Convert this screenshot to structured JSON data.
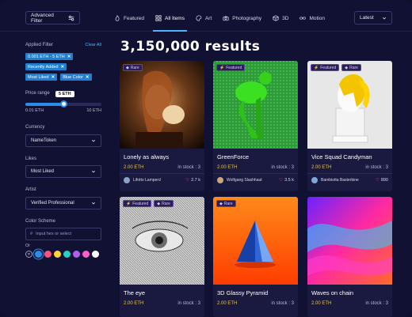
{
  "topbar": {
    "advanced_filter": "Advanced Filter",
    "tabs": [
      {
        "label": "Featured",
        "icon": "flame-icon"
      },
      {
        "label": "All Items",
        "icon": "grid-icon"
      },
      {
        "label": "Art",
        "icon": "palette-icon"
      },
      {
        "label": "Photography",
        "icon": "camera-icon"
      },
      {
        "label": "3D",
        "icon": "cube-icon"
      },
      {
        "label": "Motion",
        "icon": "glasses-icon"
      }
    ],
    "sort": "Latest"
  },
  "sidebar": {
    "applied_filter": "Applied Filter",
    "clear_all": "Clear All",
    "chips": [
      "0.001 ETH - 5 ETH",
      "Recently Added",
      "Most Liked",
      "Blue Color"
    ],
    "price_range": "Price range",
    "price_tip": "5 ETH",
    "price_level": 0.5,
    "price_min": "0.01 ETH",
    "price_max": "10 ETH",
    "currency_label": "Currency",
    "currency_value": "NameToken",
    "likes_label": "Likes",
    "likes_value": "Most Liked",
    "artist_label": "Artist",
    "artist_value": "Verified Professional",
    "color_label": "Color Scheme",
    "color_placeholder": "Input hex or select",
    "or_label": "Or",
    "swatches": [
      "#2b8de6",
      "#ff4f7b",
      "#ffd23a",
      "#22d3c5",
      "#b05cf0",
      "#ff5ec8",
      "#ffffff"
    ]
  },
  "main": {
    "results": "3,150,000 results",
    "badge_featured": "Featured",
    "badge_rare": "Rare",
    "cards": [
      {
        "title": "Lonely as always",
        "price": "2.00 ETH",
        "stock": "in stock : 3",
        "owner": "Lifotto Lamperd",
        "likes": "2.7 k"
      },
      {
        "title": "GreenForce",
        "price": "2.00 ETH",
        "stock": "in stock : 3",
        "owner": "Wolfgang Slashhaut",
        "likes": "3.5 k"
      },
      {
        "title": "Vice Squad Candyman",
        "price": "2.00 ETH",
        "stock": "in stock : 3",
        "owner": "Bambiotta Basterbine",
        "likes": "890"
      },
      {
        "title": "The eye",
        "price": "2.00 ETH",
        "stock": "in stock : 3",
        "owner": "",
        "likes": ""
      },
      {
        "title": "3D Glassy Pyramid",
        "price": "2.00 ETH",
        "stock": "in stock : 3",
        "owner": "",
        "likes": ""
      },
      {
        "title": "Waves on chain",
        "price": "2.00 ETH",
        "stock": "in stock : 3",
        "owner": "",
        "likes": ""
      }
    ]
  }
}
